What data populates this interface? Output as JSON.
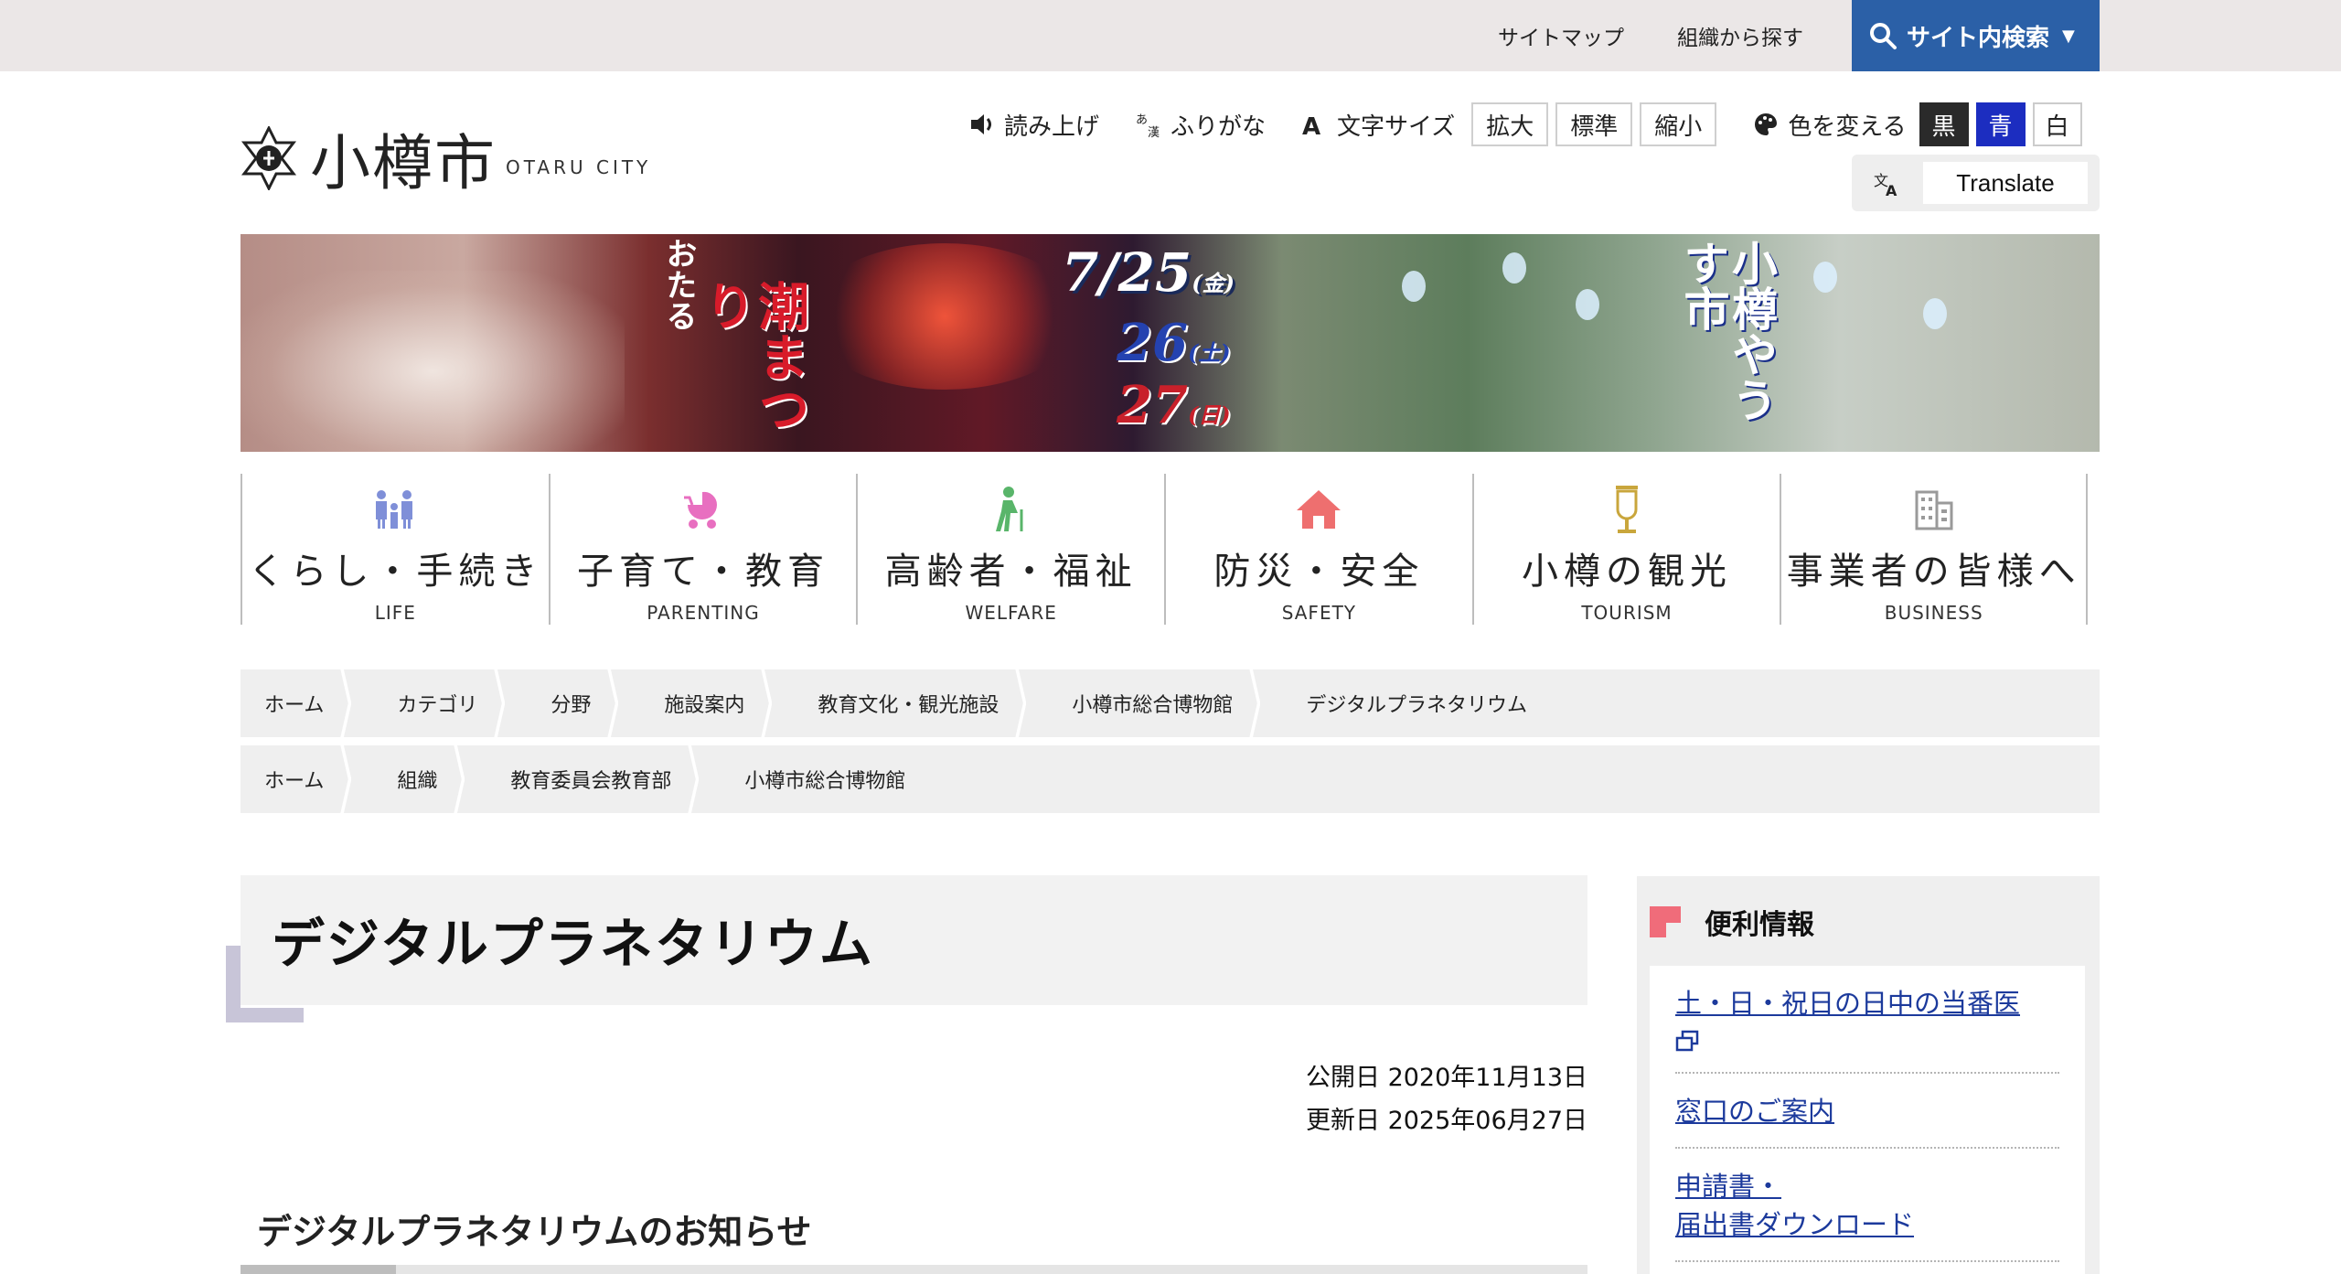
{
  "topbar": {
    "sitemap": "サイトマップ",
    "org_search": "組織から探す",
    "site_search": "サイト内検索"
  },
  "logo": {
    "name": "小樽市",
    "sub": "OTARU CITY"
  },
  "tools": {
    "read_aloud": "読み上げ",
    "furigana": "ふりがな",
    "text_size": "文字サイズ",
    "enlarge": "拡大",
    "standard": "標準",
    "shrink": "縮小",
    "change_color": "色を変える",
    "black": "黒",
    "blue": "青",
    "white": "白",
    "translate": "Translate"
  },
  "banner": {
    "festival_small": "おたる",
    "festival_big": "潮まつり",
    "date1": "7/25",
    "date1_dow": "(金)",
    "date2": "26",
    "date2_dow": "(土)",
    "date3": "27",
    "date3_dow": "(日)",
    "market": "小樽やうす市"
  },
  "categories": [
    {
      "jp": "くらし・手続き",
      "en": "LIFE",
      "icon": "family-icon",
      "color": "#7f8fd8"
    },
    {
      "jp": "子育て・教育",
      "en": "PARENTING",
      "icon": "stroller-icon",
      "color": "#e86fc0"
    },
    {
      "jp": "高齢者・福祉",
      "en": "WELFARE",
      "icon": "elderly-icon",
      "color": "#59b56a"
    },
    {
      "jp": "防災・安全",
      "en": "SAFETY",
      "icon": "house-icon",
      "color": "#ee6f6f"
    },
    {
      "jp": "小樽の観光",
      "en": "TOURISM",
      "icon": "lamp-icon",
      "color": "#c9a63c"
    },
    {
      "jp": "事業者の皆様へ",
      "en": "BUSINESS",
      "icon": "building-icon",
      "color": "#9a9a9a"
    }
  ],
  "breadcrumb1": [
    "ホーム",
    "カテゴリ",
    "分野",
    "施設案内",
    "教育文化・観光施設",
    "小樽市総合博物館",
    "デジタルプラネタリウム"
  ],
  "breadcrumb2": [
    "ホーム",
    "組織",
    "教育委員会教育部",
    "小樽市総合博物館"
  ],
  "page": {
    "title": "デジタルプラネタリウム",
    "published": "公開日 2020年11月13日",
    "updated": "更新日 2025年06月27日",
    "section": "デジタルプラネタリウムのお知らせ"
  },
  "side": {
    "heading": "便利情報",
    "links": [
      "土・日・祝日の日中の当番医",
      "窓口のご案内",
      "申請書・",
      "届出書ダウンロード"
    ]
  }
}
